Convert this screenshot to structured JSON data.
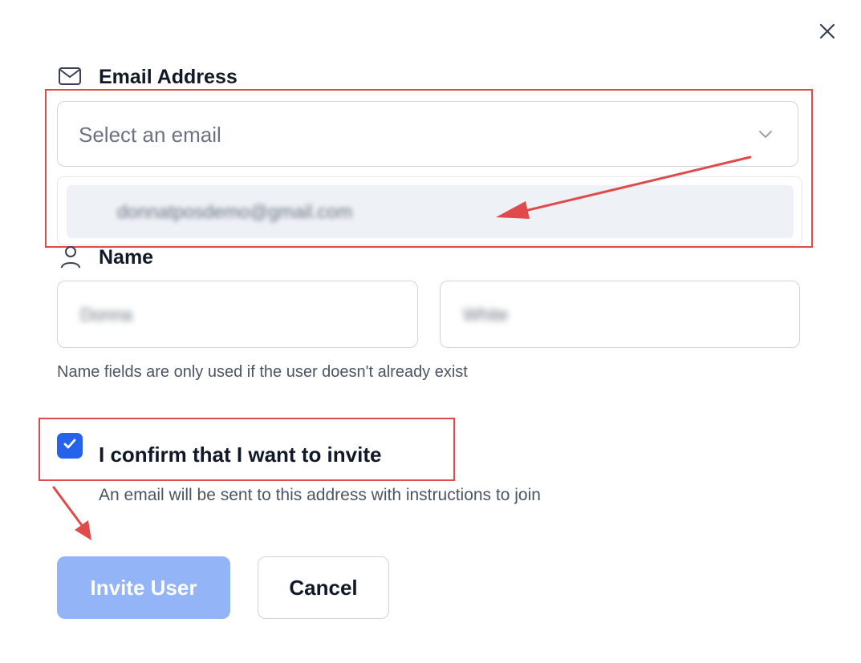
{
  "close_button": {
    "icon": "close-icon"
  },
  "email_section": {
    "title": "Email Address",
    "icon": "mail-icon",
    "select": {
      "placeholder": "Select an email",
      "icon": "chevron-down-icon"
    },
    "options": [
      "donnatposdemo@gmail.com"
    ]
  },
  "name_section": {
    "title": "Name",
    "icon": "user-icon",
    "first_name_value": "Donna",
    "last_name_value": "White",
    "helper_text": "Name fields are only used if the user doesn't already exist"
  },
  "confirm": {
    "checked": true,
    "label": "I confirm that I want to invite",
    "description": "An email will be sent to this address with instructions to join"
  },
  "actions": {
    "invite_label": "Invite User",
    "cancel_label": "Cancel"
  },
  "colors": {
    "accent": "#2563eb",
    "primary_disabled": "#93b4f6",
    "annotation": "#e04a4a"
  }
}
